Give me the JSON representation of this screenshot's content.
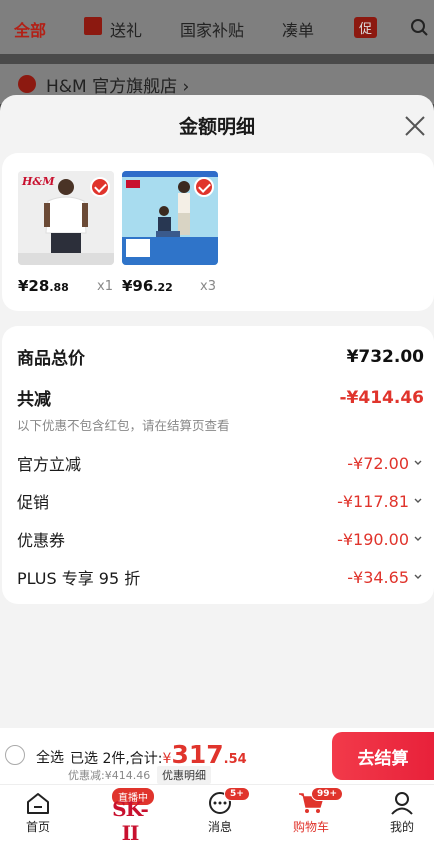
{
  "background": {
    "tabs": [
      "全部",
      "送礼",
      "国家补贴",
      "凑单"
    ],
    "promo_tag": "促",
    "shop_name": "H&M 官方旗舰店 ›"
  },
  "sheet": {
    "title": "金额明细",
    "products": [
      {
        "price_int": "¥28",
        "price_dec": ".88",
        "qty": "x1"
      },
      {
        "price_int": "¥96",
        "price_dec": ".22",
        "qty": "x3"
      }
    ],
    "summary": {
      "total_label": "商品总价",
      "total_value": "¥732.00",
      "discount_label": "共减",
      "discount_value": "-¥414.46",
      "note": "以下优惠不包含红包，请在结算页查看",
      "lines": [
        {
          "label": "官方立减",
          "value": "-¥72.00"
        },
        {
          "label": "促销",
          "value": "-¥117.81"
        },
        {
          "label": "优惠券",
          "value": "-¥190.00"
        },
        {
          "label": "PLUS 专享 95 折",
          "value": "-¥34.65"
        }
      ]
    }
  },
  "checkout": {
    "select_all": "全选",
    "selected_text": "已选 2件,合计:",
    "total_symbol": "¥",
    "total_int": "317",
    "total_dec": ".54",
    "discount_text": "优惠减:¥414.46",
    "detail_tag": "优惠明细",
    "pay_label": "去结算"
  },
  "tabbar": {
    "home": "首页",
    "live_badge": "直播中",
    "brand": "SK-II",
    "messages": "消息",
    "messages_badge": "5+",
    "cart": "购物车",
    "cart_badge": "99+",
    "mine": "我的"
  },
  "colors": {
    "accent": "#e0342c",
    "pay_gradient": "#f23a4a"
  }
}
